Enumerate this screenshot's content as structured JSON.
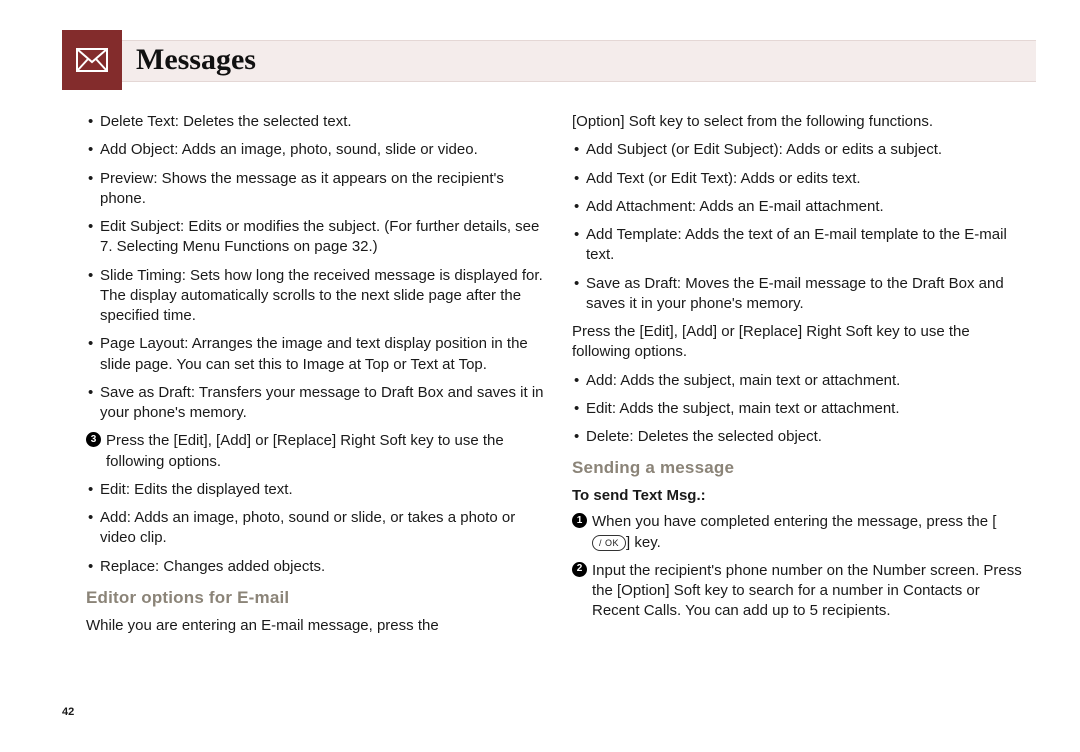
{
  "header": {
    "title": "Messages",
    "icon": "envelope-icon"
  },
  "page_number": "42",
  "left": {
    "bullets_a": [
      "Delete Text: Deletes the selected text.",
      "Add Object: Adds an image, photo, sound, slide or video.",
      "Preview: Shows the message as it appears on the recipient's phone.",
      "Edit Subject: Edits or modifies the subject. (For further details, see 7. Selecting Menu Functions on page 32.)",
      "Slide Timing: Sets how long the received message is displayed for. The display automatically scrolls to the next slide page after the specified time.",
      "Page Layout: Arranges the image and text display position in the slide page. You can set this to Image at Top or Text at Top.",
      "Save as Draft: Transfers your message to Draft Box and saves it in your phone's memory."
    ],
    "step3": "Press the [Edit], [Add] or [Replace] Right Soft key to use the following options.",
    "bullets_b": [
      "Edit: Edits the displayed text.",
      "Add: Adds an image, photo, sound or slide, or takes a photo or video clip.",
      "Replace: Changes added objects."
    ],
    "subhead": "Editor options for E-mail",
    "tail": "While you are entering an E-mail message, press the"
  },
  "right": {
    "lead": "[Option] Soft key to select from the following functions.",
    "bullets_a": [
      "Add Subject (or Edit Subject): Adds or edits a subject.",
      "Add Text (or Edit Text): Adds or edits text.",
      "Add Attachment: Adds an E-mail attachment.",
      "Add Template: Adds the text of an E-mail template to the E-mail text.",
      "Save as Draft: Moves the E-mail message to the Draft Box and saves it in your phone's memory."
    ],
    "mid": "Press the [Edit], [Add] or [Replace] Right Soft key to use the following options.",
    "bullets_b": [
      "Add: Adds the subject, main text or attachment.",
      "Edit: Adds the subject, main text or attachment.",
      "Delete: Deletes the selected object."
    ],
    "subhead": "Sending a message",
    "bold": "To send Text Msg.:",
    "step1_a": "When you have completed entering the message, press the [",
    "step1_key": "/ OK",
    "step1_b": "] key.",
    "step2": "Input the recipient's phone number on the Number screen. Press the [Option] Soft key to search for a number in Contacts or Recent Calls. You can add up to 5 recipients."
  }
}
